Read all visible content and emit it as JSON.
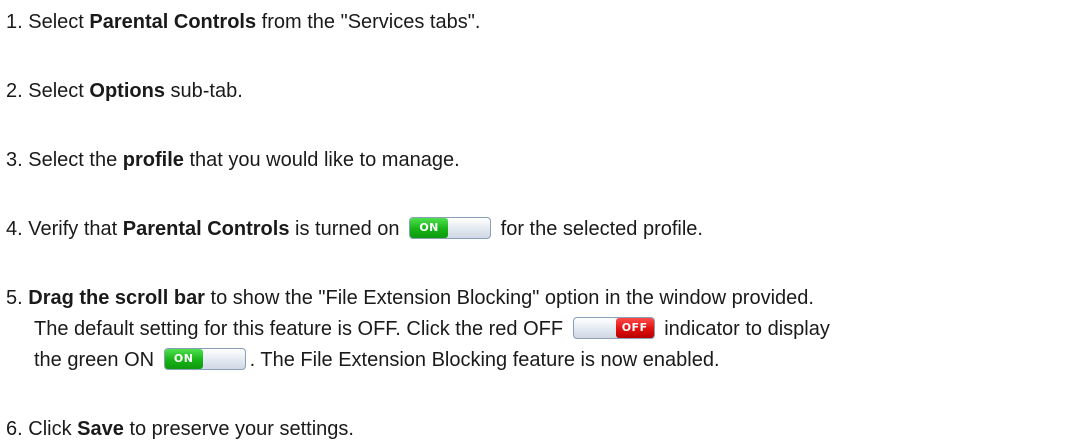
{
  "steps": {
    "s1": {
      "num": "1.",
      "pre": "Select",
      "bold": "Parental Controls",
      "post": "from the \"Services tabs\"."
    },
    "s2": {
      "num": "2.",
      "pre": "Select",
      "bold": "Options",
      "post": "sub-tab."
    },
    "s3": {
      "num": "3.",
      "pre": "Select the",
      "bold": "profile",
      "post": "that you would like to manage."
    },
    "s4": {
      "num": "4.",
      "pre": "Verify that",
      "bold": "Parental Controls",
      "mid": "is turned on",
      "post": "for the selected profile."
    },
    "s5": {
      "num": "5.",
      "bold": "Drag the scroll bar",
      "line1_post": "to show the \"File Extension Blocking\" option in the window provided.",
      "line2_pre": "The default setting for this feature is OFF. Click the red OFF",
      "line2_post": "indicator to display",
      "line3_pre": "the green ON",
      "line3_post": ". The File Extension Blocking feature is now enabled."
    },
    "s6": {
      "num": "6.",
      "pre": "Click",
      "bold": "Save",
      "post": "to preserve your settings."
    }
  },
  "toggles": {
    "on_label": "ON",
    "off_label": "OFF",
    "on_color": "#17b317",
    "off_color": "#e01010"
  }
}
